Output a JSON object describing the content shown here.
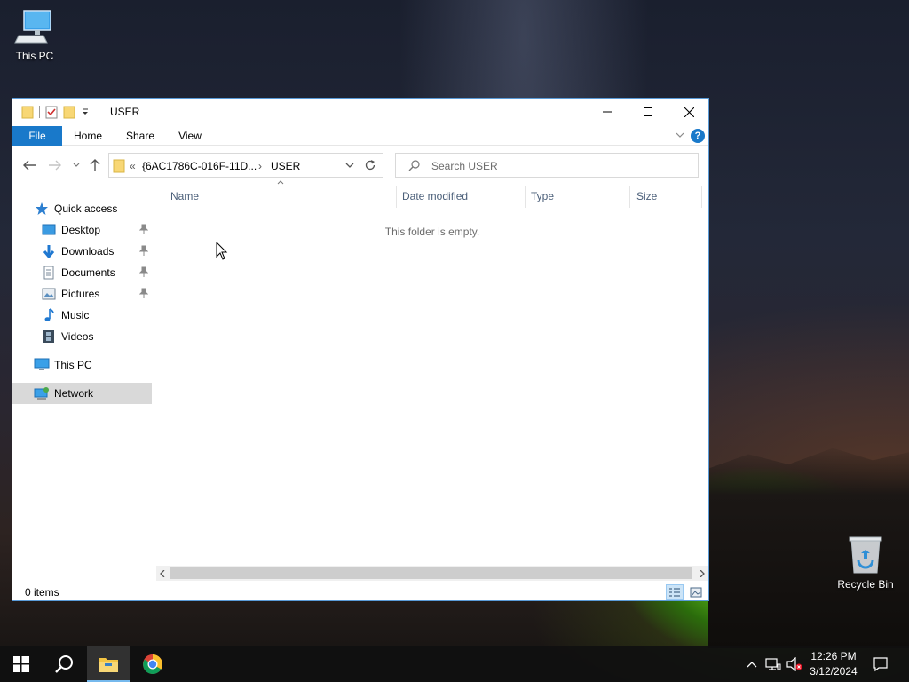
{
  "desktop": {
    "icons": [
      {
        "label": "This PC"
      },
      {
        "label": "Recycle Bin"
      }
    ]
  },
  "window": {
    "title": "USER",
    "ribbon_tabs": [
      "File",
      "Home",
      "Share",
      "View"
    ],
    "help_label": "?",
    "address": {
      "overflow": "«",
      "crumbs": [
        "{6AC1786C-016F-11D...",
        "USER"
      ],
      "separator": "›"
    },
    "search_placeholder": "Search USER",
    "nav": {
      "quick_access": "Quick access",
      "pinned": [
        "Desktop",
        "Downloads",
        "Documents",
        "Pictures"
      ],
      "unpinned": [
        "Music",
        "Videos"
      ],
      "this_pc": "This PC",
      "network": "Network",
      "selected": "Network"
    },
    "columns": [
      "Name",
      "Date modified",
      "Type",
      "Size"
    ],
    "empty_message": "This folder is empty.",
    "status": "0 items"
  },
  "taskbar": {
    "time": "12:26 PM",
    "date": "3/12/2024"
  },
  "colors": {
    "accent": "#1979ca",
    "selection": "#d9d9d9",
    "taskbar": "#101010",
    "folder": "#f8d775"
  }
}
